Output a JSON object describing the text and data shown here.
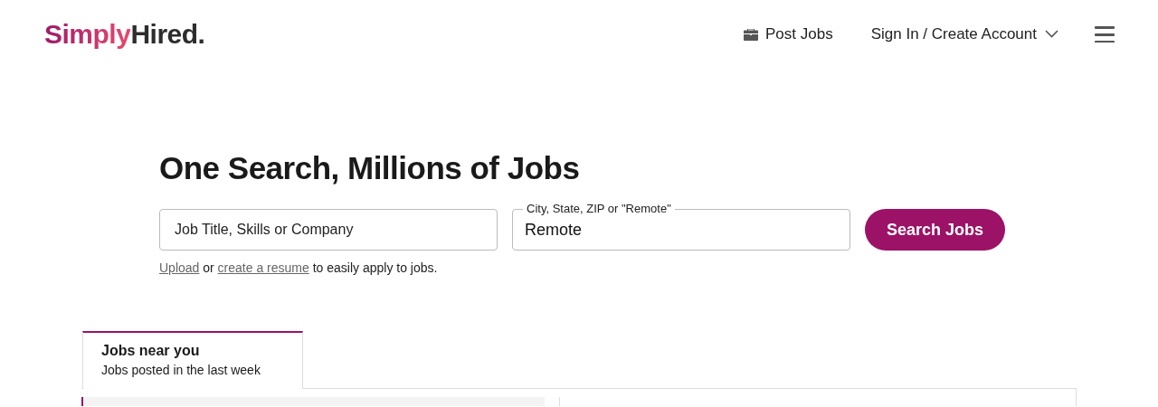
{
  "header": {
    "logo": {
      "first": "Simply",
      "second": "Hired."
    },
    "post_jobs": "Post Jobs",
    "account": "Sign In / Create Account"
  },
  "hero": {
    "title": "One Search, Millions of Jobs",
    "what_field": {
      "placeholder": "Job Title, Skills or Company"
    },
    "where_field": {
      "label": "City, State, ZIP or \"Remote\"",
      "value": "Remote"
    },
    "search_button": "Search Jobs",
    "resume_note": {
      "upload_link": "Upload",
      "or": "or",
      "create_link": "create a resume",
      "rest": "to easily apply to jobs."
    }
  },
  "tabs": [
    {
      "title": "Jobs near you",
      "subtitle": "Jobs posted in the last week",
      "selected": true
    }
  ],
  "job_list": [
    {
      "kind": "card",
      "selected": true
    }
  ]
}
